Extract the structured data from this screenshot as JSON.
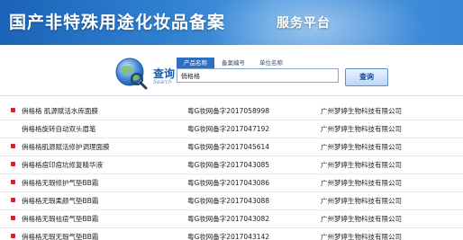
{
  "header": {
    "title": "国产非特殊用途化妆品备案",
    "subtitle": "服务平台"
  },
  "search": {
    "label": "查询",
    "sublabel": "Search",
    "tabs": [
      "产品名称",
      "备案编号",
      "单位名称"
    ],
    "query": "俏格格",
    "button_label": "查询"
  },
  "results": [
    {
      "name": "俏格格 肌源赋活水库面膜",
      "code": "粤G妆网备字2017058998",
      "company": "广州梦婷生物科技有限公司",
      "marked": true
    },
    {
      "name": "俏格格旋转自动双头眉笔",
      "code": "粤G妆网备字2017047192",
      "company": "广州梦婷生物科技有限公司",
      "marked": false
    },
    {
      "name": "俏格格肌源赋活修护调理面膜",
      "code": "粤G妆网备字2017045614",
      "company": "广州梦婷生物科技有限公司",
      "marked": true
    },
    {
      "name": "俏格格痘印痘坑修复精华液",
      "code": "粤G妆网备字2017043085",
      "company": "广州梦婷生物科技有限公司",
      "marked": true
    },
    {
      "name": "俏格格无瑕修护气垫BB霜",
      "code": "粤G妆网备字2017043086",
      "company": "广州梦婷生物科技有限公司",
      "marked": true
    },
    {
      "name": "俏格格无瑕柔颜气垫BB霜",
      "code": "粤G妆网备字2017043088",
      "company": "广州梦婷生物科技有限公司",
      "marked": true
    },
    {
      "name": "俏格格无瑕祛痘气垫BB霜",
      "code": "粤G妆网备字2017043082",
      "company": "广州梦婷生物科技有限公司",
      "marked": true
    },
    {
      "name": "俏格格无瑕无瑕气垫BB霜",
      "code": "粤G妆网备字2017043142",
      "company": "广州梦婷生物科技有限公司",
      "marked": true
    }
  ],
  "colors": {
    "banner": "#2f7fd0",
    "marker": "#c9232b"
  }
}
